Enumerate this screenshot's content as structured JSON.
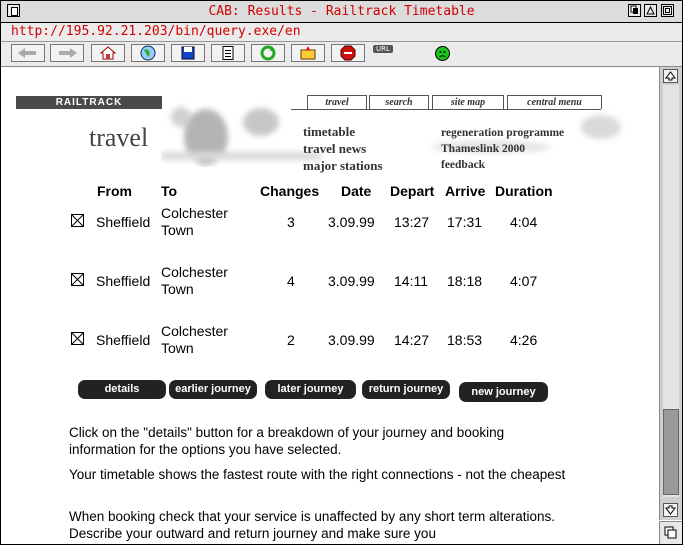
{
  "window": {
    "title": "CAB: Results - Railtrack Timetable",
    "url": "http://195.92.21.203/bin/query.exe/en",
    "url_badge": "URL"
  },
  "toolbar": {
    "icons": [
      "back-arrow-icon",
      "forward-arrow-icon",
      "home-icon",
      "globe-icon",
      "save-disk-icon",
      "document-icon",
      "reload-icon",
      "hotlist-icon",
      "stop-icon"
    ]
  },
  "site": {
    "brand": "RAILTRACK",
    "section_title": "travel",
    "tabs": [
      "travel",
      "search",
      "site map",
      "central menu"
    ],
    "links_left": [
      "timetable",
      "travel news",
      "major stations"
    ],
    "links_right": [
      "regeneration programme",
      "Thameslink 2000",
      "feedback"
    ]
  },
  "results": {
    "headers": [
      "From",
      "To",
      "Changes",
      "Date",
      "Depart",
      "Arrive",
      "Duration"
    ],
    "rows": [
      {
        "from": "Sheffield",
        "to_line1": "Colchester",
        "to_line2": "Town",
        "changes": "3",
        "date": "3.09.99",
        "depart": "13:27",
        "arrive": "17:31",
        "duration": "4:04"
      },
      {
        "from": "Sheffield",
        "to_line1": "Colchester",
        "to_line2": "Town",
        "changes": "4",
        "date": "3.09.99",
        "depart": "14:11",
        "arrive": "18:18",
        "duration": "4:07"
      },
      {
        "from": "Sheffield",
        "to_line1": "Colchester",
        "to_line2": "Town",
        "changes": "2",
        "date": "3.09.99",
        "depart": "14:27",
        "arrive": "18:53",
        "duration": "4:26"
      }
    ]
  },
  "actions": {
    "details": "details",
    "earlier": "earlier journey",
    "later": "later journey",
    "return": "return journey",
    "new": "new journey"
  },
  "info": {
    "p1": "Click on the \"details\" button for a breakdown of your journey and booking information for the options you have selected.",
    "p2": "Your timetable shows the fastest route with the right connections - not the cheapest",
    "p3": "When booking check that your service is unaffected by any short term alterations. Describe your outward and return journey and make sure you"
  }
}
